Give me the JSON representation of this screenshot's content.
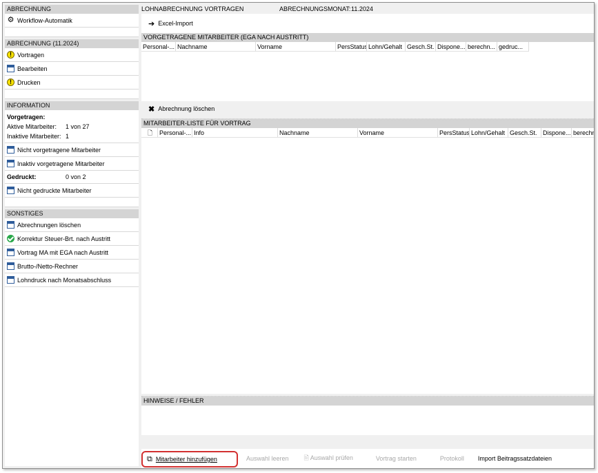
{
  "sidebar": {
    "sec_abrechnung": "ABRECHNUNG",
    "workflow": "Workflow-Automatik",
    "sec_abrechnung_month": "ABRECHNUNG (11.2024)",
    "vortragen": "Vortragen",
    "bearbeiten": "Bearbeiten",
    "drucken": "Drucken",
    "sec_information": "INFORMATION",
    "vorgetragen_label": "Vorgetragen:",
    "aktive_label": "Aktive Mitarbeiter:",
    "aktive_value": "1 von 27",
    "inaktive_label": "Inaktive Mitarbeiter:",
    "inaktive_value": "1",
    "nicht_vorgetragene": "Nicht vorgetragene Mitarbeiter",
    "inaktiv_vorgetragene": "Inaktiv vorgetragene Mitarbeiter",
    "gedruckt_label": "Gedruckt:",
    "gedruckt_value": "0 von 2",
    "nicht_gedruckte": "Nicht gedruckte Mitarbeiter",
    "sec_sonstiges": "SONSTIGES",
    "abrechnungen_loeschen": "Abrechnungen löschen",
    "korrektur": "Korrektur Steuer-Brt. nach Austritt",
    "vortrag_ma": "Vortrag MA mit EGA nach Austritt",
    "brutto_netto": "Brutto-/Netto-Rechner",
    "lohndruck": "Lohndruck nach Monatsabschluss"
  },
  "main": {
    "title": "LOHNABRECHNUNG VORTRAGEN",
    "month_label": "ABRECHNUNGSMONAT:",
    "month_value": "11.2024",
    "excel_import": "Excel-Import",
    "grid1_header": "VORGETRAGENE MITARBEITER (EGA NACH AUSTRITT)",
    "grid1_cols": [
      "Personal-...",
      "Nachname",
      "Vorname",
      "PersStatus",
      "Lohn/Gehalt",
      "Gesch.St.",
      "Dispone...",
      "berechn...",
      "gedruc..."
    ],
    "abrechnung_loeschen": "Abrechnung löschen",
    "grid2_header": "MITARBEITER-LISTE FÜR VORTRAG",
    "grid2_cols": [
      "Personal-...",
      "Info",
      "Nachname",
      "Vorname",
      "PersStatus",
      "Lohn/Gehalt",
      "Gesch.St.",
      "Dispone...",
      "berechn"
    ],
    "hinweise_header": "HINWEISE / FEHLER"
  },
  "bottom": {
    "add": "Mitarbeiter hinzufügen",
    "clear": "Auswahl leeren",
    "check": "Auswahl prüfen",
    "start": "Vortrag starten",
    "protokoll": "Protokoll",
    "import": "Import Beitragssatzdateien"
  }
}
